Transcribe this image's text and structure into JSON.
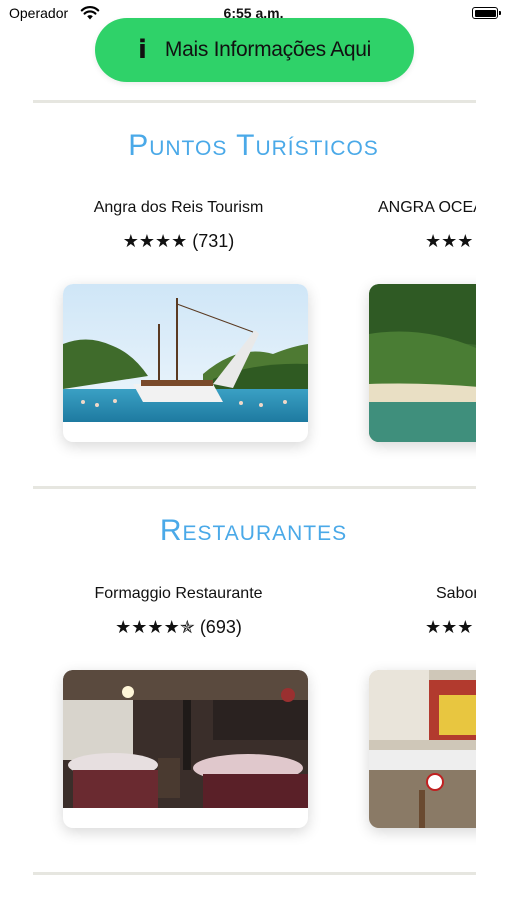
{
  "status_bar": {
    "carrier": "Operador",
    "time": "6:55 a.m."
  },
  "info_button": {
    "icon": "info-icon",
    "label": "Mais Informações Aqui",
    "color": "#2fd269"
  },
  "sections": [
    {
      "title": "Puntos Turísticos",
      "cards": [
        {
          "name": "Angra dos Reis Tourism",
          "stars": "★★★★",
          "count": "(731)",
          "photo": "boat-photo"
        },
        {
          "name": "ANGRA OCEAN",
          "stars": "★★★",
          "count": "",
          "photo": "beach-photo"
        }
      ]
    },
    {
      "title": "Restaurantes",
      "cards": [
        {
          "name": "Formaggio Restaurante",
          "stars": "★★★★✯",
          "count": "(693)",
          "photo": "restaurant-interior-photo"
        },
        {
          "name": "Sabor",
          "stars": "★★★",
          "count": "",
          "photo": "storefront-photo"
        }
      ]
    }
  ],
  "colors": {
    "accent": "#4aa9e8",
    "divider": "#e6e6e0"
  }
}
